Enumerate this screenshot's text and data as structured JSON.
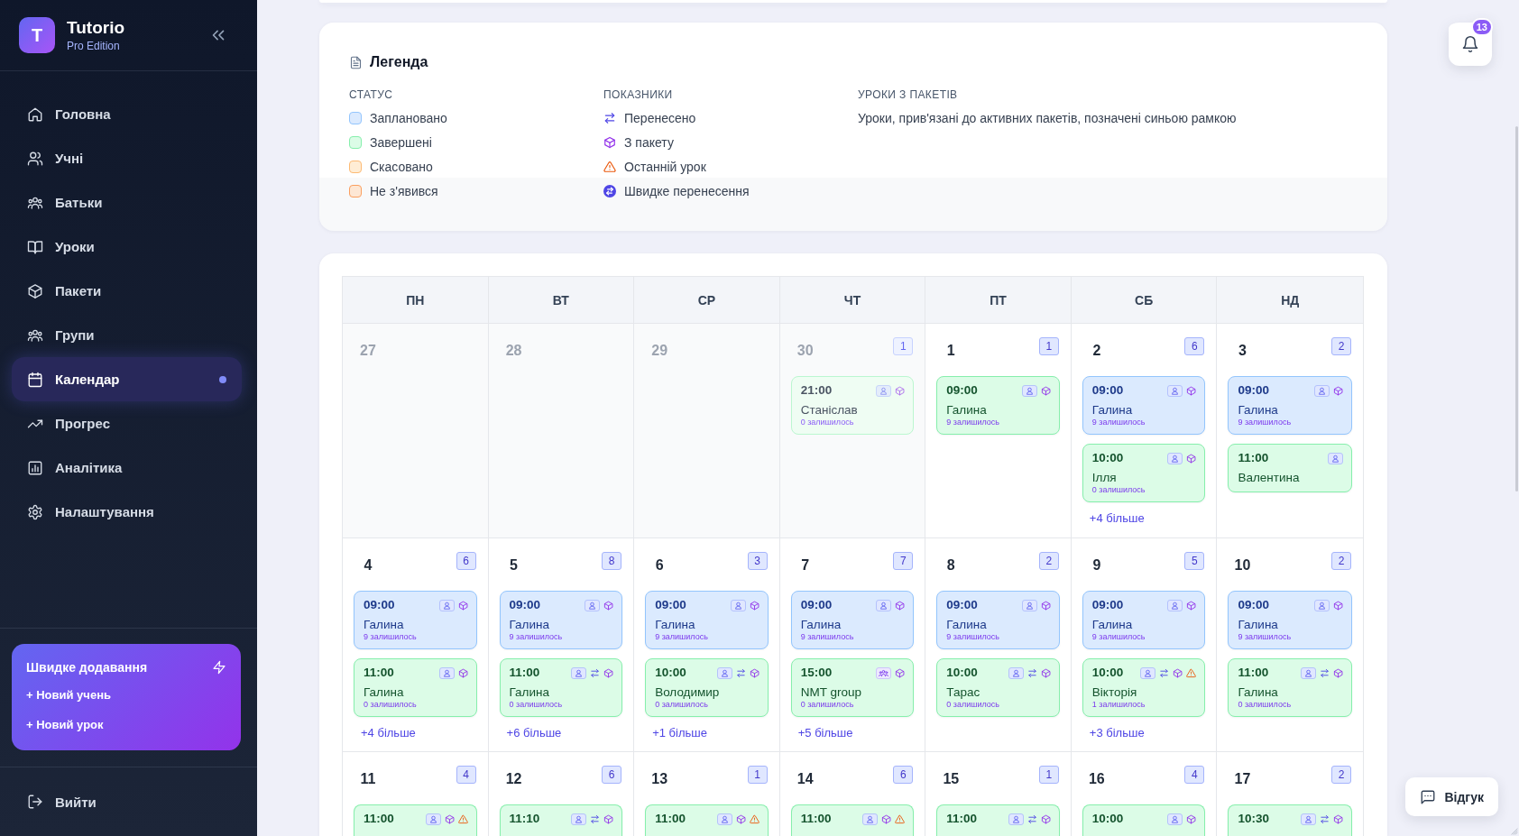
{
  "sidebar": {
    "logo": {
      "letter": "T",
      "title": "Tutorio",
      "subtitle": "Pro Edition"
    },
    "nav": [
      {
        "label": "Головна",
        "kind": "home",
        "selected": false
      },
      {
        "label": "Учні",
        "kind": "students",
        "selected": false
      },
      {
        "label": "Батьки",
        "kind": "parents",
        "selected": false
      },
      {
        "label": "Уроки",
        "kind": "lessons",
        "selected": false
      },
      {
        "label": "Пакети",
        "kind": "packages",
        "selected": false
      },
      {
        "label": "Групи",
        "kind": "groups",
        "selected": false
      },
      {
        "label": "Календар",
        "kind": "calendar",
        "selected": true
      },
      {
        "label": "Прогрес",
        "kind": "progress",
        "selected": false
      },
      {
        "label": "Аналітика",
        "kind": "analytics",
        "selected": false
      },
      {
        "label": "Налаштування",
        "kind": "settings",
        "selected": false
      }
    ],
    "quick_add": {
      "title": "Швидке додавання",
      "actions": [
        "+ Новий учень",
        "+ Новий урок"
      ]
    },
    "logout": {
      "label": "Вийти"
    }
  },
  "legend": {
    "title": "Легенда",
    "status": {
      "heading": "СТАТУС",
      "items": [
        {
          "label": "Заплановано",
          "kind": "planned"
        },
        {
          "label": "Завершені",
          "kind": "completed"
        },
        {
          "label": "Скасовано",
          "kind": "cancelled"
        },
        {
          "label": "Не з'явився",
          "kind": "no_show"
        }
      ]
    },
    "indicators": {
      "heading": "ПОКАЗНИКИ",
      "items": [
        {
          "label": "Перенесено",
          "kind": "rescheduled"
        },
        {
          "label": "З пакету",
          "kind": "package"
        },
        {
          "label": "Останній урок",
          "kind": "last_lesson"
        },
        {
          "label": "Швидке перенесення",
          "kind": "quick_reschedule"
        }
      ]
    },
    "packages": {
      "heading": "УРОКИ З ПАКЕТІВ",
      "text": "Уроки, прив'язані до активних пакетів, позначені синьою рамкою"
    }
  },
  "calendar": {
    "weekdays": [
      "ПН",
      "ВТ",
      "СР",
      "ЧТ",
      "ПТ",
      "СБ",
      "НД"
    ],
    "weeks": [
      {
        "days": [
          {
            "day": "27",
            "current_month": false
          },
          {
            "day": "28",
            "current_month": false
          },
          {
            "day": "29",
            "current_month": false
          },
          {
            "day": "30",
            "current_month": false,
            "count": "1",
            "events": [
              {
                "time": "21:00",
                "name": "Станіслав",
                "remaining": "0 залишилось",
                "kind": "completed",
                "group": false,
                "rescheduled": false,
                "from_package": true,
                "last_lesson": false
              }
            ]
          },
          {
            "day": "1",
            "current_month": true,
            "count": "1",
            "events": [
              {
                "time": "09:00",
                "name": "Галина",
                "remaining": "9 залишилось",
                "kind": "completed",
                "group": false,
                "rescheduled": false,
                "from_package": true,
                "last_lesson": false
              }
            ]
          },
          {
            "day": "2",
            "current_month": true,
            "count": "6",
            "events": [
              {
                "time": "09:00",
                "name": "Галина",
                "remaining": "9 залишилось",
                "kind": "planned",
                "group": false,
                "rescheduled": false,
                "from_package": true,
                "last_lesson": false
              },
              {
                "time": "10:00",
                "name": "Ілля",
                "remaining": "0 залишилось",
                "kind": "completed",
                "group": false,
                "rescheduled": false,
                "from_package": true,
                "last_lesson": false
              }
            ],
            "more": "+4 більше"
          },
          {
            "day": "3",
            "current_month": true,
            "count": "2",
            "events": [
              {
                "time": "09:00",
                "name": "Галина",
                "remaining": "9 залишилось",
                "kind": "planned",
                "group": false,
                "rescheduled": false,
                "from_package": true,
                "last_lesson": false
              },
              {
                "time": "11:00",
                "name": "Валентина",
                "kind": "completed",
                "group": false,
                "rescheduled": false,
                "from_package": false,
                "last_lesson": false
              }
            ]
          }
        ]
      },
      {
        "days": [
          {
            "day": "4",
            "current_month": true,
            "count": "6",
            "events": [
              {
                "time": "09:00",
                "name": "Галина",
                "remaining": "9 залишилось",
                "kind": "planned",
                "group": false,
                "rescheduled": false,
                "from_package": true,
                "last_lesson": false
              },
              {
                "time": "11:00",
                "name": "Галина",
                "remaining": "0 залишилось",
                "kind": "completed",
                "group": false,
                "rescheduled": false,
                "from_package": true,
                "last_lesson": false
              }
            ],
            "more": "+4 більше"
          },
          {
            "day": "5",
            "current_month": true,
            "count": "8",
            "events": [
              {
                "time": "09:00",
                "name": "Галина",
                "remaining": "9 залишилось",
                "kind": "planned",
                "group": false,
                "rescheduled": false,
                "from_package": true,
                "last_lesson": false
              },
              {
                "time": "11:00",
                "name": "Галина",
                "remaining": "0 залишилось",
                "kind": "completed",
                "group": false,
                "rescheduled": true,
                "from_package": true,
                "last_lesson": false
              }
            ],
            "more": "+6 більше"
          },
          {
            "day": "6",
            "current_month": true,
            "count": "3",
            "events": [
              {
                "time": "09:00",
                "name": "Галина",
                "remaining": "9 залишилось",
                "kind": "planned",
                "group": false,
                "rescheduled": false,
                "from_package": true,
                "last_lesson": false
              },
              {
                "time": "10:00",
                "name": "Володимир",
                "remaining": "0 залишилось",
                "kind": "completed",
                "group": false,
                "rescheduled": true,
                "from_package": true,
                "last_lesson": false
              }
            ],
            "more": "+1 більше"
          },
          {
            "day": "7",
            "current_month": true,
            "count": "7",
            "events": [
              {
                "time": "09:00",
                "name": "Галина",
                "remaining": "9 залишилось",
                "kind": "planned",
                "group": false,
                "rescheduled": false,
                "from_package": true,
                "last_lesson": false
              },
              {
                "time": "15:00",
                "name": "NMT group",
                "remaining": "0 залишилось",
                "kind": "completed",
                "group": true,
                "rescheduled": false,
                "from_package": true,
                "last_lesson": false
              }
            ],
            "more": "+5 більше"
          },
          {
            "day": "8",
            "current_month": true,
            "count": "2",
            "events": [
              {
                "time": "09:00",
                "name": "Галина",
                "remaining": "9 залишилось",
                "kind": "planned",
                "group": false,
                "rescheduled": false,
                "from_package": true,
                "last_lesson": false
              },
              {
                "time": "10:00",
                "name": "Тарас",
                "remaining": "0 залишилось",
                "kind": "completed",
                "group": false,
                "rescheduled": true,
                "from_package": true,
                "last_lesson": false
              }
            ]
          },
          {
            "day": "9",
            "current_month": true,
            "count": "5",
            "events": [
              {
                "time": "09:00",
                "name": "Галина",
                "remaining": "9 залишилось",
                "kind": "planned",
                "group": false,
                "rescheduled": false,
                "from_package": true,
                "last_lesson": false
              },
              {
                "time": "10:00",
                "name": "Вікторія",
                "remaining": "1 залишилось",
                "kind": "completed",
                "group": false,
                "rescheduled": true,
                "from_package": true,
                "last_lesson": true
              }
            ],
            "more": "+3 більше"
          },
          {
            "day": "10",
            "current_month": true,
            "count": "2",
            "events": [
              {
                "time": "09:00",
                "name": "Галина",
                "remaining": "9 залишилось",
                "kind": "planned",
                "group": false,
                "rescheduled": false,
                "from_package": true,
                "last_lesson": false
              },
              {
                "time": "11:00",
                "name": "Галина",
                "remaining": "0 залишилось",
                "kind": "completed",
                "group": false,
                "rescheduled": true,
                "from_package": true,
                "last_lesson": false
              }
            ]
          }
        ]
      },
      {
        "days": [
          {
            "day": "11",
            "current_month": true,
            "count": "4",
            "events": [
              {
                "time": "11:00",
                "kind": "completed",
                "group": false,
                "rescheduled": false,
                "from_package": true,
                "last_lesson": true
              }
            ]
          },
          {
            "day": "12",
            "current_month": true,
            "count": "6",
            "events": [
              {
                "time": "11:10",
                "kind": "completed",
                "group": false,
                "rescheduled": true,
                "from_package": true,
                "last_lesson": false
              }
            ]
          },
          {
            "day": "13",
            "current_month": true,
            "count": "1",
            "events": [
              {
                "time": "11:00",
                "kind": "completed",
                "group": false,
                "rescheduled": false,
                "from_package": true,
                "last_lesson": true
              }
            ]
          },
          {
            "day": "14",
            "current_month": true,
            "count": "6",
            "events": [
              {
                "time": "11:00",
                "kind": "completed",
                "group": false,
                "rescheduled": false,
                "from_package": true,
                "last_lesson": true
              }
            ]
          },
          {
            "day": "15",
            "current_month": true,
            "count": "1",
            "events": [
              {
                "time": "11:00",
                "kind": "completed",
                "group": false,
                "rescheduled": true,
                "from_package": true,
                "last_lesson": false
              }
            ]
          },
          {
            "day": "16",
            "current_month": true,
            "count": "4",
            "events": [
              {
                "time": "10:00",
                "kind": "completed",
                "group": false,
                "rescheduled": false,
                "from_package": true,
                "last_lesson": false
              }
            ]
          },
          {
            "day": "17",
            "current_month": true,
            "count": "2",
            "events": [
              {
                "time": "10:30",
                "kind": "completed",
                "group": false,
                "rescheduled": true,
                "from_package": true,
                "last_lesson": false
              }
            ]
          }
        ]
      }
    ]
  },
  "notifications": {
    "count": "13"
  },
  "feedback_button": {
    "label": "Відгук"
  }
}
